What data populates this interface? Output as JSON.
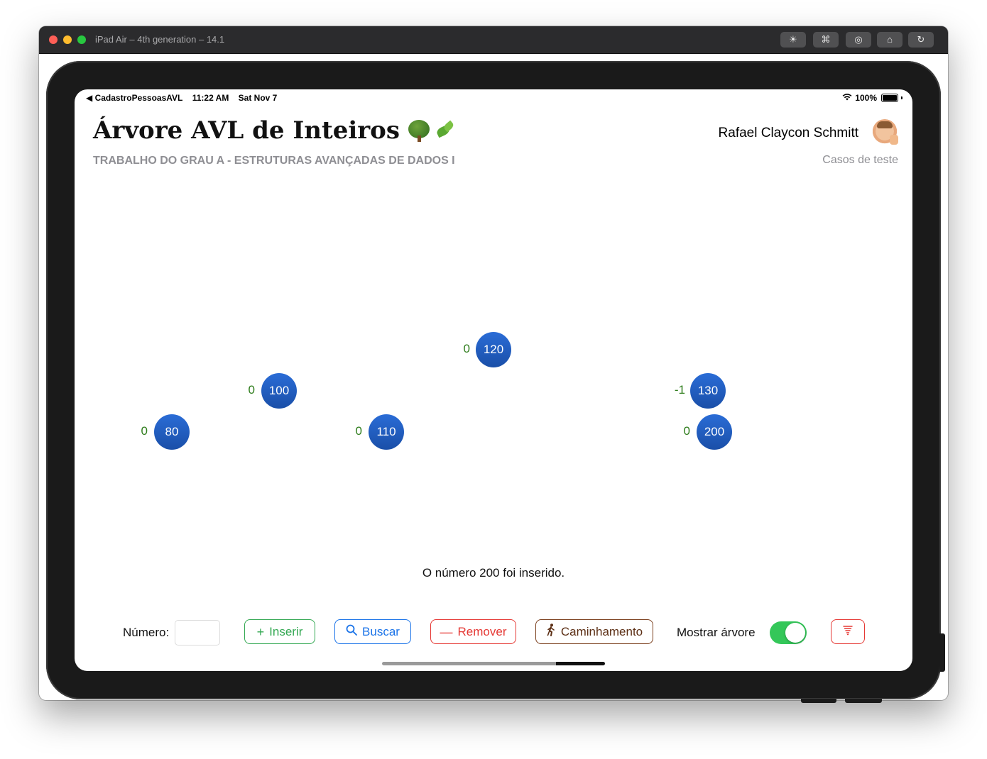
{
  "simulator": {
    "title": "iPad Air – 4th generation – 14.1",
    "toolbar_icons": [
      "brightness-icon",
      "command-icon",
      "screenshot-icon",
      "home-icon",
      "rotate-icon"
    ]
  },
  "status_bar": {
    "back_app": "◀ CadastroPessoasAVL",
    "time": "11:22 AM",
    "date": "Sat Nov 7",
    "battery": "100%"
  },
  "header": {
    "title": "Árvore AVL de Inteiros",
    "subtitle": "TRABALHO DO GRAU A - ESTRUTURAS AVANÇADAS DE DADOS I",
    "author": "Rafael Claycon Schmitt",
    "test_cases_link": "Casos de teste"
  },
  "tree": {
    "nodes": [
      {
        "value": "120",
        "balance": "0"
      },
      {
        "value": "100",
        "balance": "0"
      },
      {
        "value": "130",
        "balance": "-1"
      },
      {
        "value": "80",
        "balance": "0"
      },
      {
        "value": "110",
        "balance": "0"
      },
      {
        "value": "200",
        "balance": "0"
      }
    ],
    "colors": {
      "node": "#1f5ec4",
      "balance": "#2f7d1c"
    }
  },
  "message": "O número 200 foi inserido.",
  "controls": {
    "number_label": "Número:",
    "number_value": "",
    "insert_label": "Inserir",
    "search_label": "Buscar",
    "remove_label": "Remover",
    "traversal_label": "Caminhamento",
    "show_tree_label": "Mostrar árvore",
    "show_tree_on": true
  },
  "colors": {
    "insert": "#34a853",
    "search": "#1a73e8",
    "remove": "#e53935",
    "traversal": "#7b3f1d",
    "toggle_on": "#34c759"
  }
}
